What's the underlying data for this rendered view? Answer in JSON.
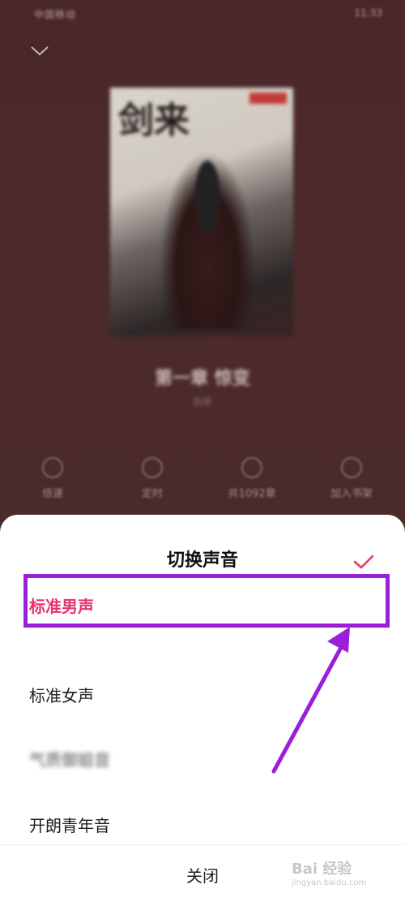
{
  "status_bar": {
    "left_text": "中国移动",
    "right_text": "11:33"
  },
  "player": {
    "book_title": "第一章 惊变",
    "book_subtitle": "剑来",
    "cover_calligraphy": "剑来",
    "controls": [
      {
        "label": "倍速",
        "icon": "speed-icon"
      },
      {
        "label": "定时",
        "icon": "timer-icon"
      },
      {
        "label": "共1092章",
        "icon": "chapter-list-icon"
      },
      {
        "label": "加入书架",
        "icon": "bookshelf-icon"
      }
    ]
  },
  "sheet": {
    "title": "切换声音",
    "options": [
      {
        "label": "标准男声",
        "selected": true
      },
      {
        "label": "标准女声",
        "selected": false
      },
      {
        "label": "气质御姐音",
        "selected": false
      },
      {
        "label": "开朗青年音",
        "selected": false
      }
    ],
    "close_label": "关闭"
  },
  "annotation": {
    "box_color": "#9a1fd6",
    "arrow_color": "#9a1fd6"
  },
  "colors": {
    "accent": "#e8336b",
    "background_dim": "#4a2628"
  },
  "watermark": {
    "text": "Bai 经验",
    "sub": "jingyan.baidu.com"
  }
}
